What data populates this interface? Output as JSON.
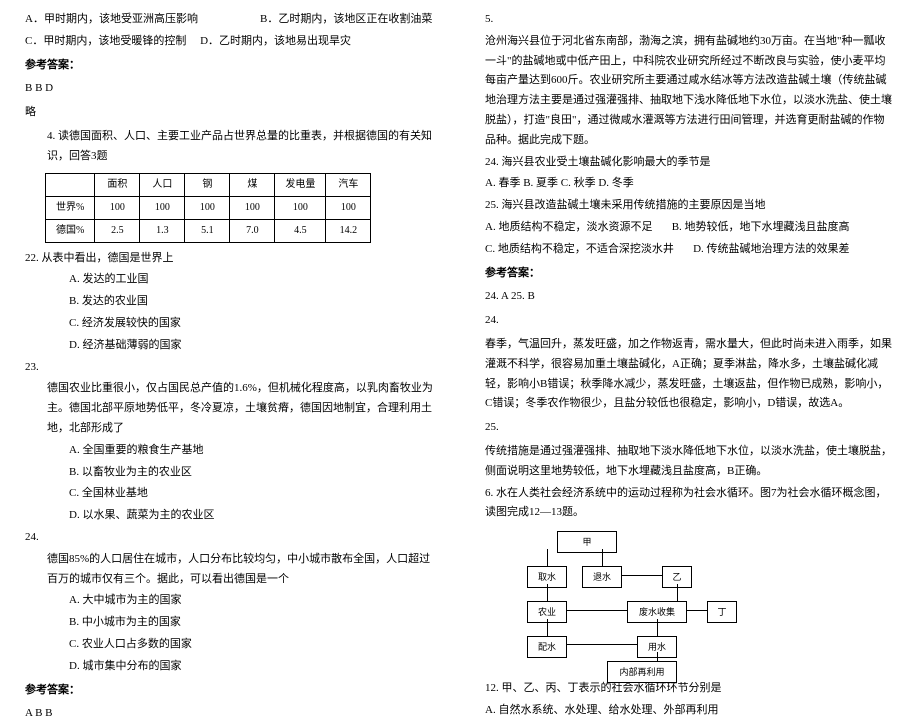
{
  "left": {
    "opt_a": "A．甲时期内，该地受亚洲高压影响",
    "opt_b": "B．乙时期内，该地区正在收割油菜",
    "opt_c": "C．甲时期内，该地受暖锋的控制",
    "opt_d": "D．乙时期内，该地易出现旱灾",
    "ans_label1": "参考答案：",
    "ans_val1": "B  B  D",
    "lue": "略",
    "q4_title": "4. 读德国面积、人口、主要工业产品占世界总量的比重表，并根据德国的有关知识，回答3题",
    "table": {
      "headers": [
        "",
        "面积",
        "人口",
        "钢",
        "煤",
        "发电量",
        "汽车"
      ],
      "row1": [
        "世界%",
        "100",
        "100",
        "100",
        "100",
        "100",
        "100"
      ],
      "row2": [
        "德国%",
        "2.5",
        "1.3",
        "5.1",
        "7.0",
        "4.5",
        "14.2"
      ]
    },
    "q22": "22.  从表中看出，德国是世界上",
    "q22a": "A. 发达的工业国",
    "q22b": "B. 发达的农业国",
    "q22c": "C. 经济发展较快的国家",
    "q22d": "D. 经济基础薄弱的国家",
    "q23": "23.",
    "q23_desc": "德国农业比重很小，仅占国民总产值的1.6%，但机械化程度高，以乳肉畜牧业为主。德国北部平原地势低平，冬冷夏凉，土壤贫瘠，德国因地制宜，合理利用土地，北部形成了",
    "q23a": "A. 全国重要的粮食生产基地",
    "q23b": "B. 以畜牧业为主的农业区",
    "q23c": "C. 全国林业基地",
    "q23d": "D. 以水果、蔬菜为主的农业区",
    "q24": "24.",
    "q24_desc": "德国85%的人口居住在城市，人口分布比较均匀，中小城市散布全国，人口超过百万的城市仅有三个。据此，可以看出德国是一个",
    "q24a": "A. 大中城市为主的国家",
    "q24b": "B. 中小城市为主的国家",
    "q24c": "C. 农业人口占多数的国家",
    "q24d": "D. 城市集中分布的国家",
    "ans_label2": "参考答案：",
    "ans_val2": "A  B  B"
  },
  "right": {
    "q5": "5.",
    "q5_desc": "沧州海兴县位于河北省东南部，渤海之滨，拥有盐碱地约30万亩。在当地\"种一瓢收一斗\"的盐碱地或中低产田上，中科院农业研究所经过不断改良与实验，使小麦平均每亩产量达到600斤。农业研究所主要通过咸水结冰等方法改造盐碱土壤（传统盐碱地治理方法主要是通过强灌强排、抽取地下浅水降低地下水位，以淡水洗盐、使土壤脱盐），打造\"良田\"，通过微咸水灌溉等方法进行田间管理，并选育更耐盐碱的作物品种。据此完成下题。",
    "q24r": "24. 海兴县农业受土壤盐碱化影响最大的季节是",
    "q24r_opts": "A.  春季      B.  夏季      C.  秋季      D.  冬季",
    "q25r": "25. 海兴县改造盐碱土壤未采用传统措施的主要原因是当地",
    "q25r_a": "A.  地质结构不稳定，淡水资源不足",
    "q25r_b": "B.  地势较低，地下水埋藏浅且盐度高",
    "q25r_c": "C.  地质结构不稳定，不适合深挖淡水井",
    "q25r_d": "D.  传统盐碱地治理方法的效果差",
    "ans_label3": "参考答案：",
    "ans_val3": "24. A    25. B",
    "exp24_label": "24.",
    "exp24": "春季，气温回升，蒸发旺盛，加之作物返青，需水量大，但此时尚未进入雨季，如果灌溉不科学，很容易加重土壤盐碱化，A正确；夏季淋盐，降水多，土壤盐碱化减轻，影响小B错误；秋季降水减少，蒸发旺盛，土壤返盐，但作物已成熟，影响小，C错误；冬季农作物很少，且盐分较低也很稳定，影响小，D错误，故选A。",
    "exp25_label": "25.",
    "exp25": "传统措施是通过强灌强排、抽取地下淡水降低地下水位，以淡水洗盐，使土壤脱盐，侧面说明这里地势较低，地下水埋藏浅且盐度高，B正确。",
    "q6": "6. 水在人类社会经济系统中的运动过程称为社会水循环。图7为社会水循环概念图，读图完成12—13题。",
    "diagram": {
      "jia": "甲",
      "qushui": "取水",
      "tuishui": "退水",
      "yi": "乙",
      "nongye": "农业",
      "feishui": "废水收集",
      "ding": "丁",
      "peishui": "配水",
      "yongshui": "用水",
      "neibu": "内部再利用"
    },
    "q12": "12.  甲、乙、丙、丁表示的社会水循环环节分别是",
    "q12a": "A.  自然水系统、水处理、给水处理、外部再利用"
  }
}
